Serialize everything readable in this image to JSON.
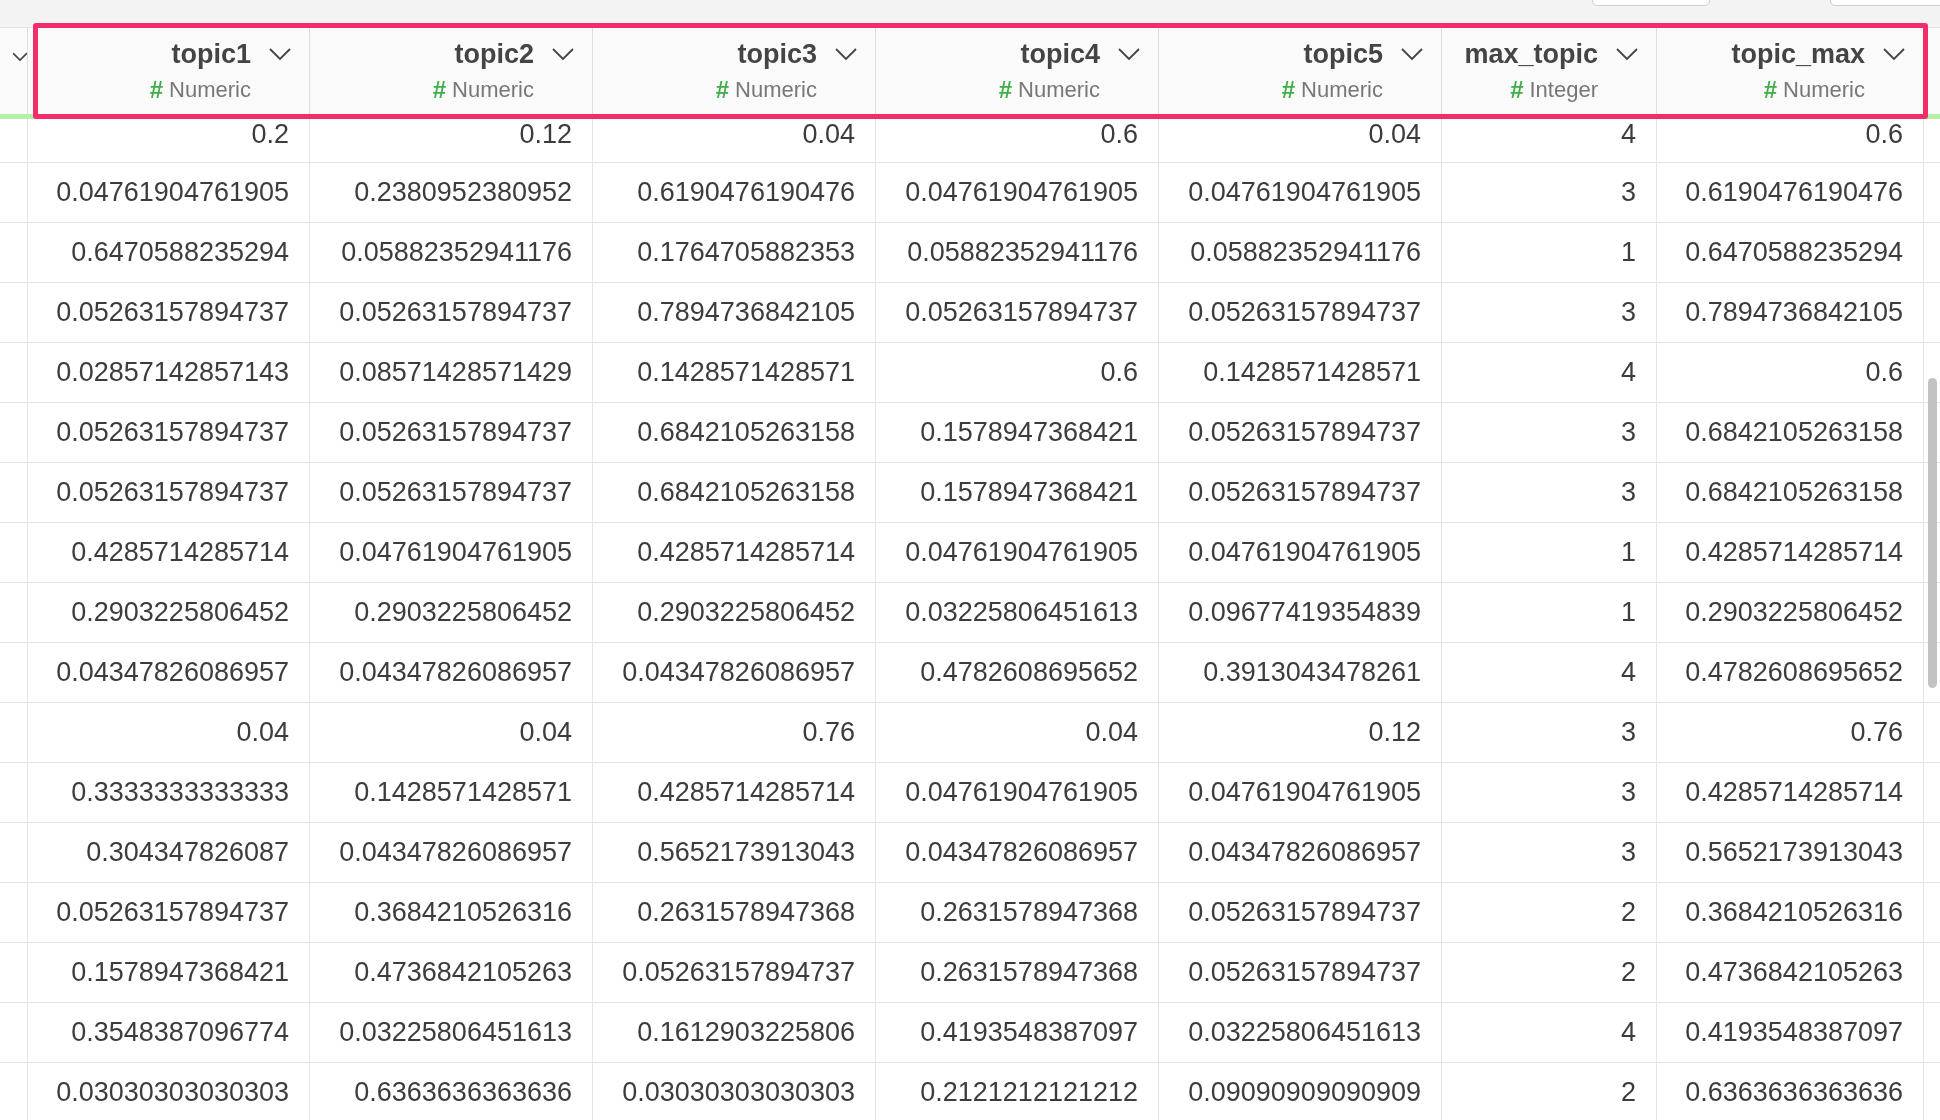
{
  "table": {
    "columns": [
      {
        "name": "topic1",
        "type_symbol": "#",
        "type": "Numeric"
      },
      {
        "name": "topic2",
        "type_symbol": "#",
        "type": "Numeric"
      },
      {
        "name": "topic3",
        "type_symbol": "#",
        "type": "Numeric"
      },
      {
        "name": "topic4",
        "type_symbol": "#",
        "type": "Numeric"
      },
      {
        "name": "topic5",
        "type_symbol": "#",
        "type": "Numeric"
      },
      {
        "name": "max_topic",
        "type_symbol": "#",
        "type": "Integer"
      },
      {
        "name": "topic_max",
        "type_symbol": "#",
        "type": "Numeric"
      }
    ],
    "rows": [
      [
        "0.2",
        "0.12",
        "0.04",
        "0.6",
        "0.04",
        "4",
        "0.6"
      ],
      [
        "0.04761904761905",
        "0.2380952380952",
        "0.6190476190476",
        "0.04761904761905",
        "0.04761904761905",
        "3",
        "0.6190476190476"
      ],
      [
        "0.6470588235294",
        "0.05882352941176",
        "0.1764705882353",
        "0.05882352941176",
        "0.05882352941176",
        "1",
        "0.6470588235294"
      ],
      [
        "0.05263157894737",
        "0.05263157894737",
        "0.7894736842105",
        "0.05263157894737",
        "0.05263157894737",
        "3",
        "0.7894736842105"
      ],
      [
        "0.02857142857143",
        "0.08571428571429",
        "0.1428571428571",
        "0.6",
        "0.1428571428571",
        "4",
        "0.6"
      ],
      [
        "0.05263157894737",
        "0.05263157894737",
        "0.6842105263158",
        "0.1578947368421",
        "0.05263157894737",
        "3",
        "0.6842105263158"
      ],
      [
        "0.05263157894737",
        "0.05263157894737",
        "0.6842105263158",
        "0.1578947368421",
        "0.05263157894737",
        "3",
        "0.6842105263158"
      ],
      [
        "0.4285714285714",
        "0.04761904761905",
        "0.4285714285714",
        "0.04761904761905",
        "0.04761904761905",
        "1",
        "0.4285714285714"
      ],
      [
        "0.2903225806452",
        "0.2903225806452",
        "0.2903225806452",
        "0.03225806451613",
        "0.09677419354839",
        "1",
        "0.2903225806452"
      ],
      [
        "0.04347826086957",
        "0.04347826086957",
        "0.04347826086957",
        "0.4782608695652",
        "0.3913043478261",
        "4",
        "0.4782608695652"
      ],
      [
        "0.04",
        "0.04",
        "0.76",
        "0.04",
        "0.12",
        "3",
        "0.76"
      ],
      [
        "0.3333333333333",
        "0.1428571428571",
        "0.4285714285714",
        "0.04761904761905",
        "0.04761904761905",
        "3",
        "0.4285714285714"
      ],
      [
        "0.304347826087",
        "0.04347826086957",
        "0.5652173913043",
        "0.04347826086957",
        "0.04347826086957",
        "3",
        "0.5652173913043"
      ],
      [
        "0.05263157894737",
        "0.3684210526316",
        "0.2631578947368",
        "0.2631578947368",
        "0.05263157894737",
        "2",
        "0.3684210526316"
      ],
      [
        "0.1578947368421",
        "0.4736842105263",
        "0.05263157894737",
        "0.2631578947368",
        "0.05263157894737",
        "2",
        "0.4736842105263"
      ],
      [
        "0.3548387096774",
        "0.03225806451613",
        "0.1612903225806",
        "0.4193548387097",
        "0.03225806451613",
        "4",
        "0.4193548387097"
      ],
      [
        "0.03030303030303",
        "0.6363636363636",
        "0.03030303030303",
        "0.2121212121212",
        "0.09090909090909",
        "2",
        "0.6363636363636"
      ]
    ]
  }
}
